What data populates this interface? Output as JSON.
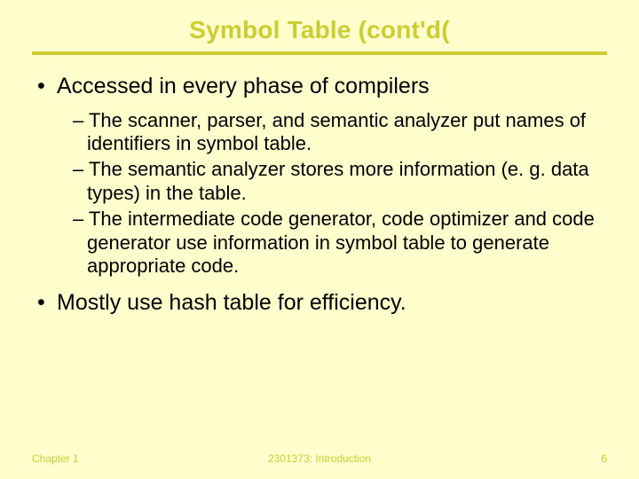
{
  "title": "Symbol Table (cont'd(",
  "bullets": [
    {
      "text": "Accessed in every phase of compilers",
      "sub": [
        "The scanner, parser, and semantic analyzer put names of identifiers in symbol table.",
        "The semantic analyzer stores more information (e. g. data types) in the table.",
        "The intermediate code generator, code optimizer and code generator use information in symbol table to generate appropriate code."
      ]
    },
    {
      "text": "Mostly use hash table for efficiency.",
      "sub": []
    }
  ],
  "footer": {
    "left": "Chapter 1",
    "center": "2301373: Introduction",
    "right": "6"
  }
}
